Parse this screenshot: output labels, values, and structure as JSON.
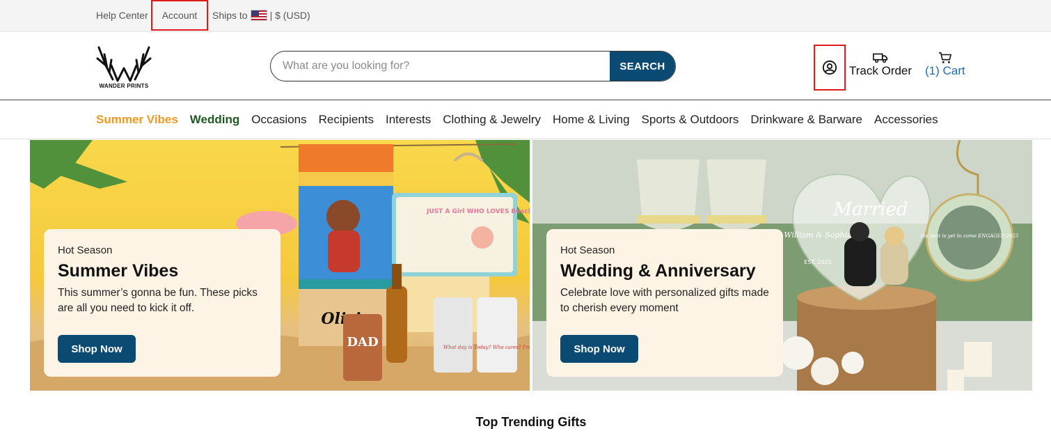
{
  "topbar": {
    "help_center": "Help Center",
    "account": "Account",
    "ships_to": "Ships to",
    "currency": "| $ (USD)"
  },
  "header": {
    "logo_text": "WANDER PRINTS",
    "search_placeholder": "What are you looking for?",
    "search_button": "SEARCH",
    "track_order": "Track Order",
    "cart_count": "(1)",
    "cart_label": "Cart"
  },
  "nav": {
    "items": [
      "Summer Vibes",
      "Wedding",
      "Occasions",
      "Recipients",
      "Interests",
      "Clothing & Jewelry",
      "Home & Living",
      "Sports & Outdoors",
      "Drinkware & Barware",
      "Accessories"
    ]
  },
  "banners": [
    {
      "eyebrow": "Hot Season",
      "heading": "Summer Vibes",
      "description": "This summer’s gonna be fun. These picks are all you need to kick it off.",
      "button": "Shop Now"
    },
    {
      "eyebrow": "Hot Season",
      "heading": "Wedding & Anniversary",
      "description": "Celebrate love with personalized gifts made to cherish every moment",
      "button": "Shop Now"
    }
  ],
  "images": {
    "towel_name": "Olivia",
    "tote_text": "JUST A Girl WHO LOVES Beaches",
    "koozie_text": "DAD",
    "tumbler_text": "What day is Today? Who cares? I'm Retired",
    "plaque_title": "Married",
    "plaque_names": "William & Sophia",
    "plaque_est": "EST. 2025",
    "ornament_text": "the best is yet to come ENGAGED 2025"
  },
  "colors": {
    "brand_blue": "#0b4a72",
    "summer_orange": "#f29a1f",
    "wedding_green": "#1f5a22",
    "highlight_red": "#e01b1b"
  },
  "section": {
    "title": "Top Trending Gifts"
  }
}
